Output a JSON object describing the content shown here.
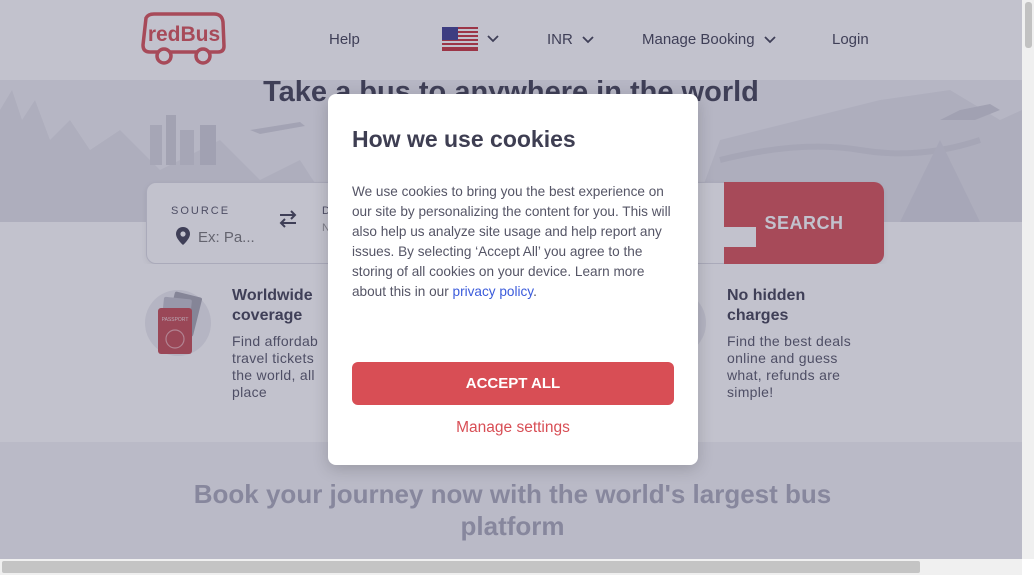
{
  "header": {
    "brand": "redBus",
    "nav": {
      "help": "Help",
      "currency": "INR",
      "manage_booking": "Manage Booking",
      "login": "Login"
    }
  },
  "hero": {
    "title": "Take a bus to anywhere in the world"
  },
  "search": {
    "source_label": "SOURCE",
    "source_placeholder": "Ex: Pa...",
    "dest_label_fragment": "D",
    "dest_placeholder_fragment": "N",
    "search_button": "SEARCH"
  },
  "features": [
    {
      "title_line1": "Worldwide",
      "title_line2": "coverage",
      "desc_lines": [
        "Find affordab",
        "travel tickets",
        "the world, all",
        "place"
      ],
      "icon_text": "PASSPORT"
    },
    {
      "title_line1": "No hidden",
      "title_line2": "charges",
      "desc_lines": [
        "Find the best deals",
        "online and guess",
        "what, refunds are",
        "simple!"
      ]
    }
  ],
  "lower": {
    "title": "Book your journey now with the world's largest bus platform"
  },
  "cookie_modal": {
    "title": "How we use cookies",
    "body": "We use cookies to bring you the best experience on our site by personalizing the content for you. This will also help us analyze site usage and help report any issues. By selecting ‘Accept All’ you agree to the storing of all cookies on your device. Learn more about this in our ",
    "link_text": "privacy policy",
    "body_end": ".",
    "accept_button": "ACCEPT ALL",
    "manage_settings": "Manage settings"
  },
  "colors": {
    "brand": "#d84e55",
    "link": "#3b5bdb",
    "text": "#3e3e52"
  }
}
